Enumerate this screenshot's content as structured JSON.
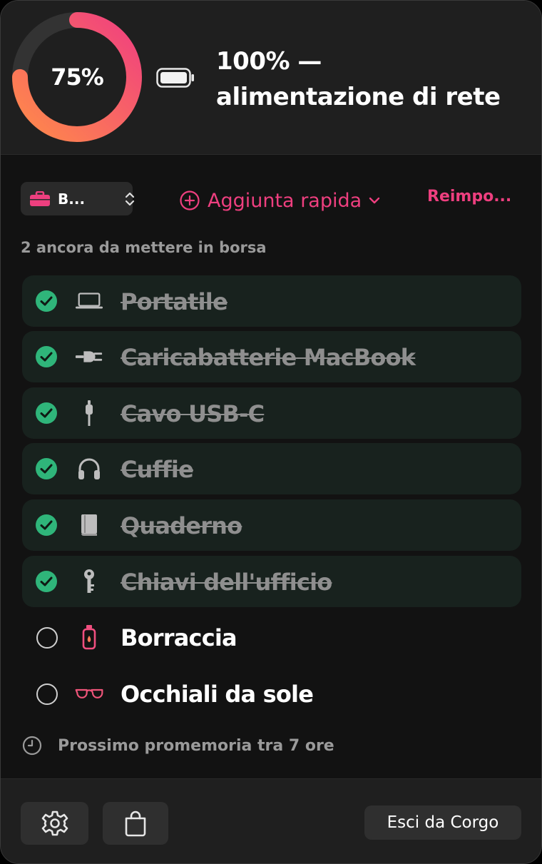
{
  "status": {
    "progress_label": "75%",
    "progress_fraction": 0.75,
    "battery_label": "100% — alimentazione di rete"
  },
  "toolbar": {
    "bag_label": "B...",
    "quick_add_label": "Aggiunta rapida",
    "reset_label": "Reimpo..."
  },
  "summary": {
    "remaining_label": "2 ancora da mettere in borsa"
  },
  "items": [
    {
      "label": "Portatile",
      "packed": true,
      "icon": "laptop-icon"
    },
    {
      "label": "Caricabatterie MacBook",
      "packed": true,
      "icon": "plug-icon"
    },
    {
      "label": "Cavo USB-C",
      "packed": true,
      "icon": "cable-icon"
    },
    {
      "label": "Cuffie",
      "packed": true,
      "icon": "headphones-icon"
    },
    {
      "label": "Quaderno",
      "packed": true,
      "icon": "book-icon"
    },
    {
      "label": "Chiavi dell'ufficio",
      "packed": true,
      "icon": "key-icon"
    },
    {
      "label": "Borraccia",
      "packed": false,
      "icon": "water-bottle-icon"
    },
    {
      "label": "Occhiali da sole",
      "packed": false,
      "icon": "sunglasses-icon"
    }
  ],
  "reminder": {
    "label": "Prossimo promemoria tra 7 ore"
  },
  "footer": {
    "quit_label": "Esci da Corgo"
  },
  "colors": {
    "accent": "#ee3f7f",
    "ring_start": "#ff7a59",
    "ring_end": "#f0407f",
    "check": "#2fb57a",
    "panel": "#121212",
    "header": "#1f1f1f"
  }
}
